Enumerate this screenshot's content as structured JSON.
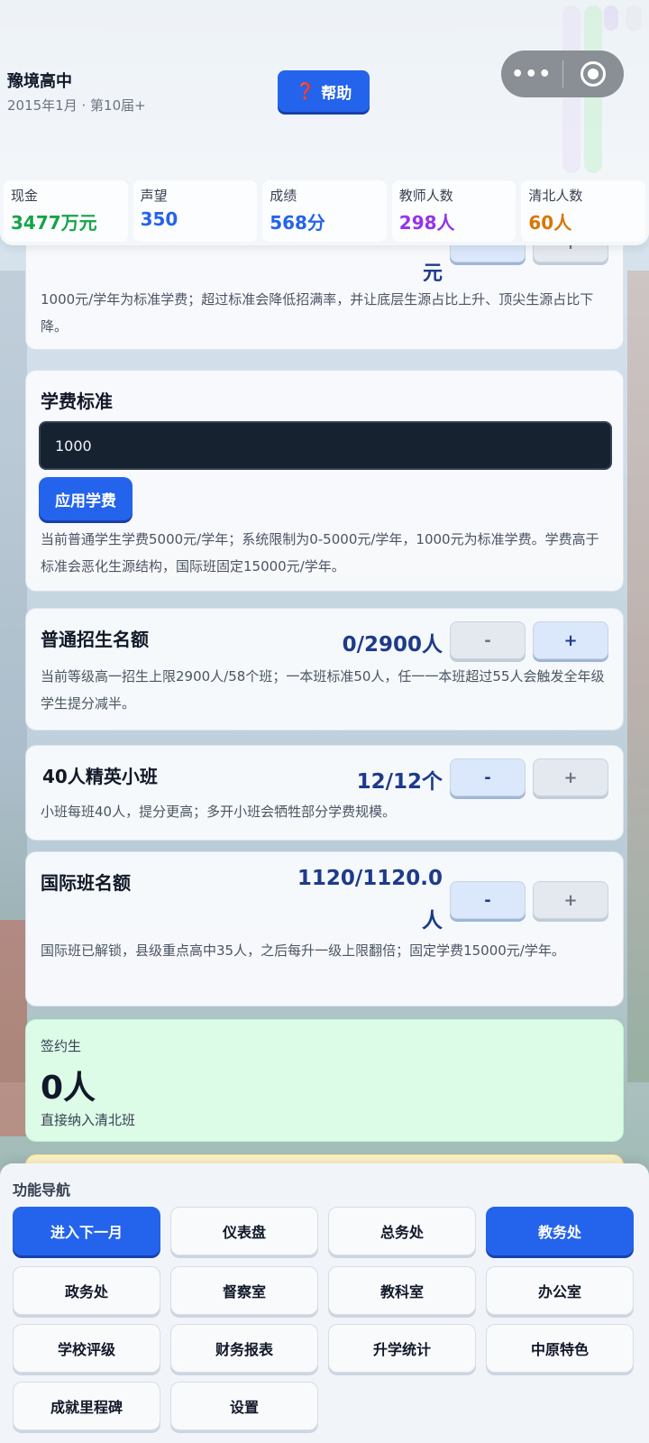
{
  "header": {
    "school_name": "豫境高中",
    "date": "2015年1月 · 第10届+",
    "help_label": "帮助",
    "help_icon": "❓",
    "capsule_dots": "•••"
  },
  "stats": [
    {
      "label": "现金",
      "value": "3477万元",
      "color": "#16a34a"
    },
    {
      "label": "声望",
      "value": "350",
      "color": "#2563eb"
    },
    {
      "label": "成绩",
      "value": "568分",
      "color": "#2563eb"
    },
    {
      "label": "教师人数",
      "value": "298人",
      "color": "#9333ea"
    },
    {
      "label": "清北人数",
      "value": "60人",
      "color": "#d97706"
    }
  ],
  "cards": {
    "partial": {
      "value_tail": "元",
      "desc": "1000元/学年为标准学费；超过标准会降低招满率，并让底层生源占比上升、顶尖生源占比下降。",
      "minus": "-",
      "plus": "+"
    },
    "tuition": {
      "title": "学费标准",
      "input_value": "1000",
      "apply_label": "应用学费",
      "desc": "当前普通学生学费5000元/学年；系统限制为0-5000元/学年，1000元为标准学费。学费高于标准会恶化生源结构，国际班固定15000元/学年。"
    },
    "enroll": {
      "title": "普通招生名额",
      "value": "0/2900人",
      "desc": "当前等级高一招生上限2900人/58个班；一本班标准50人，任一一本班超过55人会触发全年级学生提分减半。",
      "minus": "-",
      "plus": "+"
    },
    "elite": {
      "title": "40人精英小班",
      "value": "12/12个",
      "desc": "小班每班40人，提分更高；多开小班会牺牲部分学费规模。",
      "minus": "-",
      "plus": "+"
    },
    "intl": {
      "title": "国际班名额",
      "value_line1": "1120/1120.0",
      "value_line2": "人",
      "desc": "国际班已解锁，县级重点高中35人，之后每升一级上限翻倍；固定学费15000元/学年。",
      "minus": "-",
      "plus": "+"
    },
    "signed": {
      "label": "签约生",
      "value": "0人",
      "desc": "直接纳入清北班"
    }
  },
  "nav": {
    "title": "功能导航",
    "buttons": [
      {
        "label": "进入下一月",
        "primary": true
      },
      {
        "label": "仪表盘",
        "primary": false
      },
      {
        "label": "总务处",
        "primary": false
      },
      {
        "label": "教务处",
        "primary": true
      },
      {
        "label": "政务处",
        "primary": false
      },
      {
        "label": "督察室",
        "primary": false
      },
      {
        "label": "教科室",
        "primary": false
      },
      {
        "label": "办公室",
        "primary": false
      },
      {
        "label": "学校评级",
        "primary": false
      },
      {
        "label": "财务报表",
        "primary": false
      },
      {
        "label": "升学统计",
        "primary": false
      },
      {
        "label": "中原特色",
        "primary": false
      },
      {
        "label": "成就里程碑",
        "primary": false
      },
      {
        "label": "设置",
        "primary": false
      }
    ]
  }
}
